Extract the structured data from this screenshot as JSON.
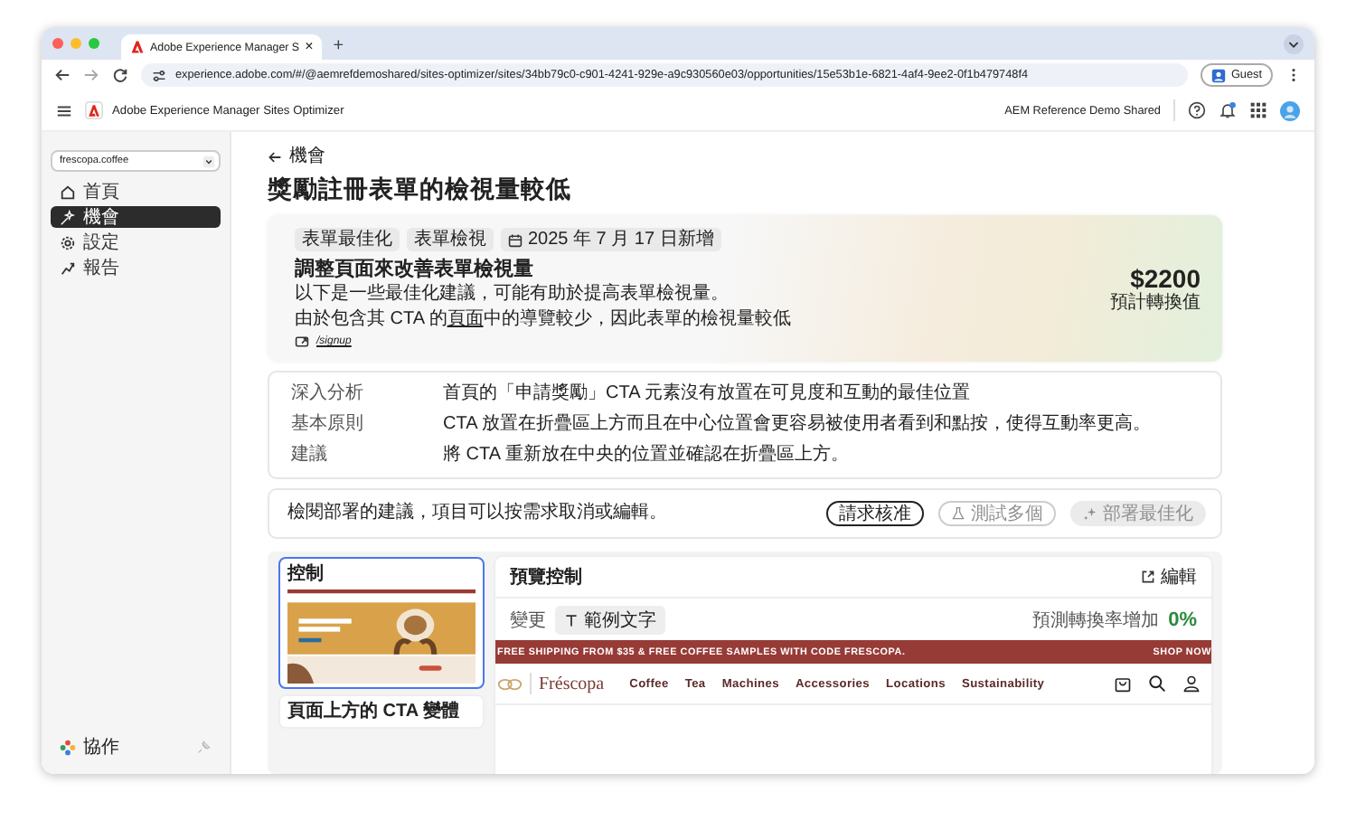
{
  "browser": {
    "tab_title": "Adobe Experience Manager S",
    "tab_close": "×",
    "new_tab": "+",
    "url": "experience.adobe.com/#/@aemrefdemoshared/sites-optimizer/sites/34bb79c0-c901-4241-929e-a9c930560e03/opportunities/15e53b1e-6821-4af4-9ee2-0f1b479748f4",
    "profile": "Guest"
  },
  "app_header": {
    "title": "Adobe Experience Manager Sites Optimizer",
    "org": "AEM Reference Demo Shared"
  },
  "sidebar": {
    "site_selector": "frescopa.coffee",
    "items": [
      {
        "label": "首頁",
        "selected": false
      },
      {
        "label": "機會",
        "selected": true
      },
      {
        "label": "設定",
        "selected": false
      },
      {
        "label": "報告",
        "selected": false
      }
    ],
    "footer": "協作"
  },
  "breadcrumb": "機會",
  "page_title": "獎勵註冊表單的檢視量較低",
  "opportunity": {
    "tags": [
      {
        "label": "表單最佳化",
        "kind": "tag"
      },
      {
        "label": "表單檢視",
        "kind": "tag"
      },
      {
        "label": "2025 年 7 月 17 日新增",
        "kind": "date"
      }
    ],
    "title": "調整頁面來改善表單檢視量",
    "description": "以下是一些最佳化建議，可能有助於提高表單檢視量。",
    "reason_before": "由於包含其 CTA 的",
    "reason_link": "頁面",
    "reason_after": "中的導覽較少，因此表單的檢視量較低",
    "page_link": "/signup",
    "value": "$2200",
    "value_label": "預計轉換值"
  },
  "insights": [
    {
      "label": "深入分析",
      "text": "首頁的「申請獎勵」CTA 元素沒有放置在可見度和互動的最佳位置"
    },
    {
      "label": "基本原則",
      "text": "CTA 放置在折疊區上方而且在中心位置會更容易被使用者看到和點按，使得互動率更高。"
    },
    {
      "label": "建議",
      "text": "將 CTA 重新放在中央的位置並確認在折疊區上方。"
    }
  ],
  "deploy": {
    "text": "檢閱部署的建議，項目可以按需求取消或編輯。",
    "buttons": [
      {
        "label": "請求核准",
        "disabled": false
      },
      {
        "label": "測試多個",
        "disabled": true
      },
      {
        "label": "部署最佳化",
        "disabled": true
      }
    ]
  },
  "variants": [
    {
      "label": "控制",
      "selected": true
    },
    {
      "label": "頁面上方的 CTA 變體",
      "selected": false
    }
  ],
  "preview": {
    "title": "預覽控制",
    "edit": "編輯",
    "change_label": "變更",
    "change_chip": "範例文字",
    "lift_label": "預測轉換率增加",
    "lift_value": "0%",
    "banner": "FREE SHIPPING FROM $35 & FREE COFFEE SAMPLES WITH CODE FRESCOPA.",
    "banner_link": "SHOP NOW",
    "logo": "Fréscopa",
    "nav": [
      "Coffee",
      "Tea",
      "Machines",
      "Accessories",
      "Locations",
      "Sustainability"
    ]
  }
}
